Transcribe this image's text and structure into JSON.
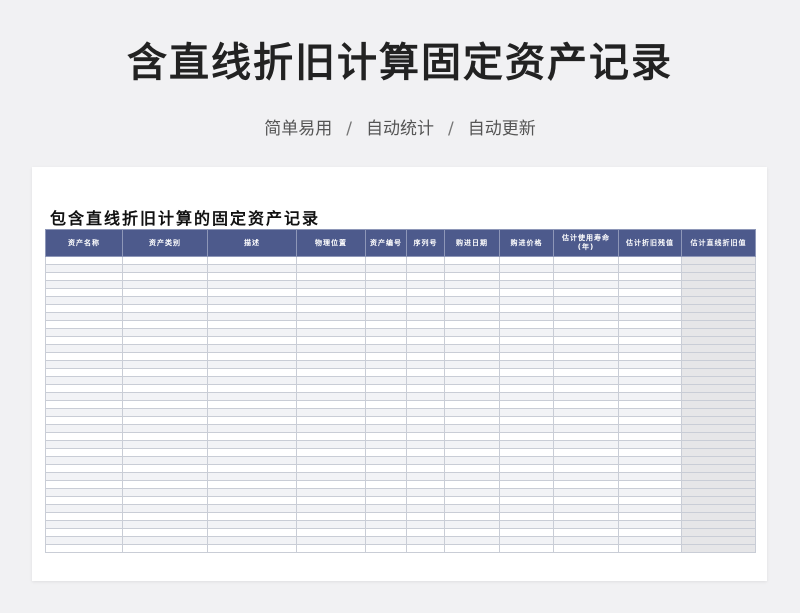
{
  "header": {
    "title": "含直线折旧计算固定资产记录",
    "tags": [
      "简单易用",
      "自动统计",
      "自动更新"
    ],
    "separator": "/"
  },
  "sheet": {
    "title": "包含直线折旧计算的固定资产记录",
    "columns": [
      "资产名称",
      "资产类别",
      "描述",
      "物理位置",
      "资产编号",
      "序列号",
      "购进日期",
      "购进价格",
      "估计使用寿命(年)",
      "估计折旧残值",
      "估计直线折旧值"
    ],
    "empty_rows": 37
  },
  "colors": {
    "header_fill": "#4d5a8c",
    "computed_column_fill": "#e6e6e8"
  }
}
